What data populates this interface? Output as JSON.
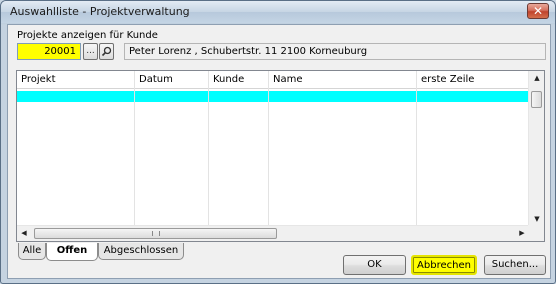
{
  "window": {
    "title": "Auswahlliste - Projektverwaltung"
  },
  "filter": {
    "label": "Projekte anzeigen für Kunde",
    "kunde_value": "20001",
    "browse_label": "...",
    "kunde_info": "Peter Lorenz  , Schubertstr. 11 2100  Korneuburg"
  },
  "grid": {
    "columns": [
      "Projekt",
      "Datum",
      "Kunde",
      "Name",
      "erste Zeile"
    ],
    "selected_row_color": "#00ffff"
  },
  "tabs": [
    {
      "label": "Alle",
      "active": false
    },
    {
      "label": "Offen",
      "active": true
    },
    {
      "label": "Abgeschlossen",
      "active": false
    }
  ],
  "buttons": {
    "ok": "OK",
    "cancel": "Abbrechen",
    "search": "Suchen..."
  },
  "colors": {
    "highlight": "#ffff00",
    "selection": "#00ffff"
  }
}
